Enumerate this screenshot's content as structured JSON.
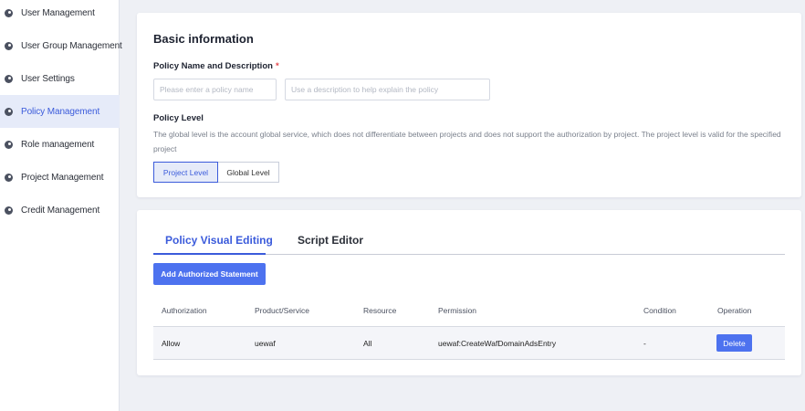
{
  "sidebar": {
    "items": [
      {
        "label": "User Management",
        "active": false
      },
      {
        "label": "User Group Management",
        "active": false
      },
      {
        "label": "User Settings",
        "active": false
      },
      {
        "label": "Policy Management",
        "active": true
      },
      {
        "label": "Role management",
        "active": false
      },
      {
        "label": "Project Management",
        "active": false
      },
      {
        "label": "Credit Management",
        "active": false
      }
    ]
  },
  "basic": {
    "title": "Basic information",
    "name_label": "Policy Name and Description",
    "required_mark": "*",
    "name_placeholder": "Please enter a policy name",
    "name_value": "",
    "desc_placeholder": "Use a description to help explain the policy",
    "desc_value": "",
    "level_label": "Policy Level",
    "level_desc": "The global level is the account global service, which does not differentiate between projects and does not support the authorization by project. The project level is valid for the specified project",
    "level_options": [
      {
        "label": "Project Level",
        "selected": true
      },
      {
        "label": "Global Level",
        "selected": false
      }
    ]
  },
  "editor": {
    "tabs": [
      {
        "label": "Policy Visual Editing",
        "active": true
      },
      {
        "label": "Script Editor",
        "active": false
      }
    ],
    "add_button": "Add Authorized Statement",
    "table": {
      "headers": [
        "Authorization",
        "Product/Service",
        "Resource",
        "Permission",
        "Condition",
        "Operation"
      ],
      "rows": [
        {
          "authorization": "Allow",
          "service": "uewaf",
          "resource": "All",
          "permission": "uewaf:CreateWafDomainAdsEntry",
          "condition": "-",
          "operation": "Delete"
        }
      ]
    }
  },
  "colors": {
    "accent": "#3b5bdb",
    "primary_button": "#4d72ef",
    "page_background": "#eef0f5",
    "required": "#e5484d"
  },
  "icons": {
    "sidebar_item": "circle-bullet-icon"
  }
}
